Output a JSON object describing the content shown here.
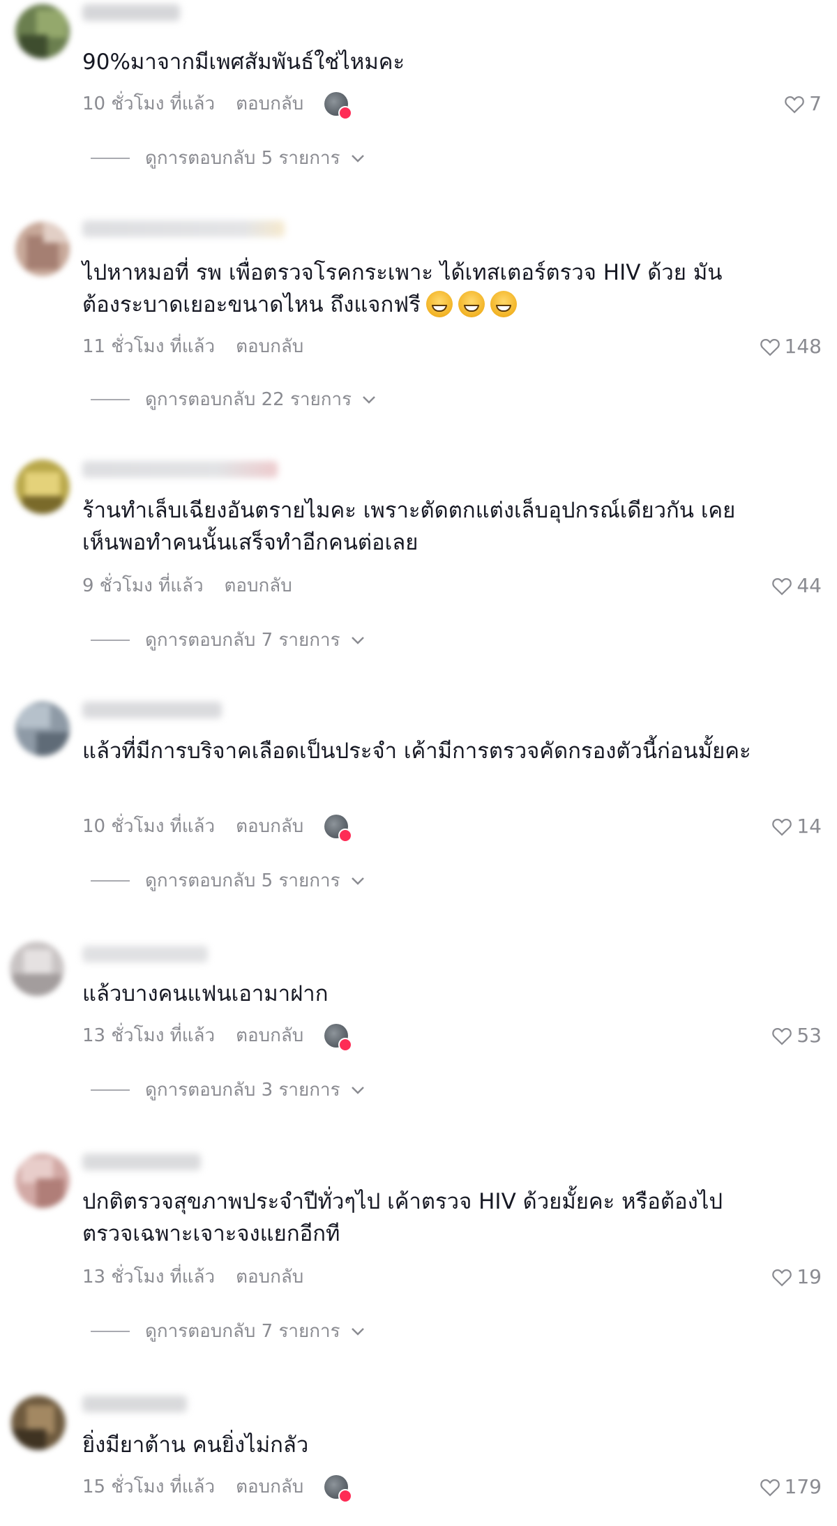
{
  "comments": [
    {
      "text": "90%มาจากมีเพศสัมพันธ์ใช่ไหมคะ",
      "time": "10 ชั่วโมง ที่แล้ว",
      "reply": "ตอบกลับ",
      "likes": "7",
      "replies": "ดูการตอบกลับ 5 รายการ",
      "creator_liked": true,
      "avatar_colors": [
        "#6b7f4f",
        "#94a86c",
        "#3e4d2e"
      ]
    },
    {
      "text": "ไปหาหมอที่ รพ เพื่อตรวจโรคกระเพาะ ได้เทสเตอร์ตรวจ HIV ด้วย มันต้องระบาดเยอะขนาดไหน ถึงแจกฟรี",
      "emoji": [
        "grinning-sweat-emoji",
        "grinning-sweat-emoji",
        "grinning-sweat-emoji"
      ],
      "time": "11 ชั่วโมง ที่แล้ว",
      "reply": "ตอบกลับ",
      "likes": "148",
      "replies": "ดูการตอบกลับ 22 รายการ",
      "creator_liked": false,
      "avatar_colors": [
        "#c8a99a",
        "#a57f72",
        "#e2cfc6"
      ]
    },
    {
      "text": "ร้านทำเล็บเฉียงอันตรายไมคะ เพราะตัดตกแต่งเล็บอุปกรณ์เดียวกัน เคยเห็นพอทำคนนั้นเสร็จทำอีกคนต่อเลย",
      "time": "9 ชั่วโมง ที่แล้ว",
      "reply": "ตอบกลับ",
      "likes": "44",
      "replies": "ดูการตอบกลับ 7 รายการ",
      "creator_liked": false,
      "avatar_colors": [
        "#b9a84a",
        "#e4d27a",
        "#7a6a2a"
      ]
    },
    {
      "text": "แล้วที่มีการบริจาคเลือดเป็นประจำ เค้ามีการตรวจคัดกรองตัวนี้ก่อนมั้ยคะ",
      "time": "10 ชั่วโมง ที่แล้ว",
      "reply": "ตอบกลับ",
      "likes": "14",
      "replies": "ดูการตอบกลับ 5 รายการ",
      "creator_liked": true,
      "avatar_colors": [
        "#8e9aa6",
        "#b6c1cb",
        "#5f6b77"
      ]
    },
    {
      "text": "แล้วบางคนแฟนเอามาฝาก",
      "time": "13 ชั่วโมง ที่แล้ว",
      "reply": "ตอบกลับ",
      "likes": "53",
      "replies": "ดูการตอบกลับ 3 รายการ",
      "creator_liked": true,
      "avatar_colors": [
        "#c9c4c4",
        "#e5e1e1",
        "#a39d9d"
      ]
    },
    {
      "text": "ปกติตรวจสุขภาพประจำปีทั่วๆไป เค้าตรวจ HIV ด้วยมั้ยคะ หรือต้องไปตรวจเฉพาะเจาะจงแยกอีกที",
      "time": "13 ชั่วโมง ที่แล้ว",
      "reply": "ตอบกลับ",
      "likes": "19",
      "replies": "ดูการตอบกลับ 7 รายการ",
      "creator_liked": false,
      "avatar_colors": [
        "#d2a9a5",
        "#e8cdca",
        "#b07e78"
      ]
    },
    {
      "text": "ยิ่งมียาต้าน คนยิ่งไม่กลัว",
      "time": "15 ชั่วโมง ที่แล้ว",
      "reply": "ตอบกลับ",
      "likes": "179",
      "creator_liked": true,
      "avatar_colors": [
        "#6e5a3e",
        "#a38862",
        "#3f3322"
      ]
    }
  ],
  "colors": {
    "text": "#161823",
    "secondary": "#8a8b91",
    "creator_badge": "#fe2c55"
  },
  "icons": {
    "like": "heart-outline-icon",
    "expand": "chevron-down-icon",
    "creator_liked": "creator-liked-icon"
  }
}
